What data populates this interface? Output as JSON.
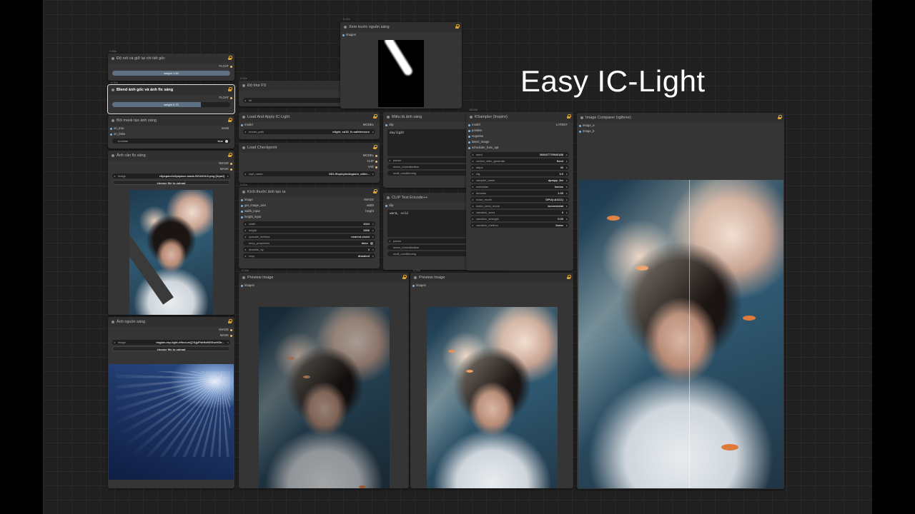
{
  "page_title": "Easy IC-Light",
  "nodes": {
    "blur_mask": {
      "badge": "0.66s",
      "title": "Độ nét và giữ lại chi tiết gốc",
      "output": "FLOAT",
      "slider_label": "weight",
      "slider_value": "1.00",
      "slider_fraction": 1.0
    },
    "blend": {
      "badge": "0.00s",
      "title": "Blend ảnh gốc và ảnh fix sáng",
      "output": "FLOAT",
      "slider_label": "weight",
      "slider_value": "0.75",
      "slider_fraction": 0.75
    },
    "mask_creator": {
      "title": "Bôi mask tạo ánh sáng",
      "inputs": [
        "on_true",
        "on_false"
      ],
      "output": "mask",
      "widget_label": "boolean",
      "widget_value": "true"
    },
    "image_fix": {
      "title": "Ảnh cần fix sáng",
      "outputs": [
        "IMAGE",
        "MASK"
      ],
      "image_label": "image",
      "image_value": "clipspace/clipspace-mask-5216418.6.png [input]",
      "upload_label": "choose file to upload"
    },
    "light_source": {
      "title": "Ảnh nguồn sáng",
      "outputs": [
        "IMAGE",
        "MASK"
      ],
      "image_label": "image",
      "image_value": "imgbin-ray-light-effect-mQ7AjyFhtr5xMGDueK5e...",
      "upload_label": "choose file to upload"
    },
    "blur_fs": {
      "badge": "0.00s",
      "title": "Độ blur FS",
      "output": "INT",
      "widget_label": "int",
      "widget_value": "4"
    },
    "preview_light": {
      "badge": "0.11s",
      "title": "Xem trước nguồn sáng",
      "input": "images"
    },
    "load_apply": {
      "title": "Load And Apply IC-Light",
      "input": "model",
      "output": "MODEL",
      "widget_label": "model_path",
      "widget_value": "iclight_sd15_fc.safetensors"
    },
    "load_checkpoint": {
      "title": "Load Checkpoint",
      "outputs": [
        "MODEL",
        "CLIP",
        "VAE"
      ],
      "widget_label": "ckpt_name",
      "widget_value": "SD1.5\\epicphotogasm_ultim..."
    },
    "image_size": {
      "badge": "0.02s",
      "title": "Kích thước ảnh tạo ra",
      "inputs": [
        "image",
        "get_image_size",
        "width_input",
        "height_input"
      ],
      "outputs": [
        "IMAGE",
        "width",
        "height"
      ],
      "widgets": [
        {
          "label": "width",
          "value": "1024"
        },
        {
          "label": "height",
          "value": "1536"
        },
        {
          "label": "upscale_method",
          "value": "nearest-exact"
        },
        {
          "label": "keep_proportion",
          "value": "false",
          "toggle": true
        },
        {
          "label": "divisible_by",
          "value": "2"
        },
        {
          "label": "crop",
          "value": "disabled"
        }
      ]
    },
    "describe": {
      "title": "Miêu tả ảnh sáng",
      "input": "clip",
      "output": "CONDITIONING",
      "text": "daylight",
      "widgets": [
        {
          "label": "parser",
          "value": "A1111"
        },
        {
          "label": "mean_normalization",
          "value": "true",
          "toggle": true
        },
        {
          "label": "multi_conditioning",
          "value": "false",
          "toggle": true
        }
      ]
    },
    "clip_encode": {
      "title": "CLIP Text Encode++",
      "input": "clip",
      "output": "CONDITIONING",
      "text": "warm, cold",
      "widgets": [
        {
          "label": "parser",
          "value": "A1111"
        },
        {
          "label": "mean_normalization",
          "value": "true",
          "toggle": true
        },
        {
          "label": "multi_conditioning",
          "value": "false",
          "toggle": true
        }
      ]
    },
    "ksampler": {
      "badge": "18.63s",
      "title": "KSampler (Inspire)",
      "inputs": [
        "model",
        "positive",
        "negative",
        "latent_image",
        "scheduler_func_opt"
      ],
      "output": "LATENT",
      "widgets": [
        {
          "label": "seed",
          "value": "393437775926188"
        },
        {
          "label": "control_after_generate",
          "value": "fixed"
        },
        {
          "label": "steps",
          "value": "40"
        },
        {
          "label": "cfg",
          "value": "3.0"
        },
        {
          "label": "sampler_name",
          "value": "dpmpp_2m"
        },
        {
          "label": "scheduler",
          "value": "karras"
        },
        {
          "label": "denoise",
          "value": "1.00"
        },
        {
          "label": "noise_mode",
          "value": "GPU(=A1111)"
        },
        {
          "label": "batch_seed_mode",
          "value": "incremental"
        },
        {
          "label": "variation_seed",
          "value": "0"
        },
        {
          "label": "variation_strength",
          "value": "0.00"
        },
        {
          "label": "variation_method",
          "value": "linear"
        }
      ]
    },
    "preview1": {
      "badge": "0.33s",
      "title": "Preview Image",
      "input": "images"
    },
    "preview2": {
      "badge": "0.37s",
      "title": "Preview Image",
      "input": "images"
    },
    "comparer": {
      "title": "Image Comparer (rgthree)",
      "inputs": [
        "image_a",
        "image_b"
      ]
    }
  },
  "colors": {
    "accent_slot_in": "#7fb2e0",
    "accent_slot_out": "#e0c070",
    "lock": "#d9a431",
    "slider_fill": "#5e7183"
  },
  "icons": [
    "lock-icon",
    "slot-dot-icon",
    "arrow-left-icon",
    "arrow-right-icon"
  ]
}
